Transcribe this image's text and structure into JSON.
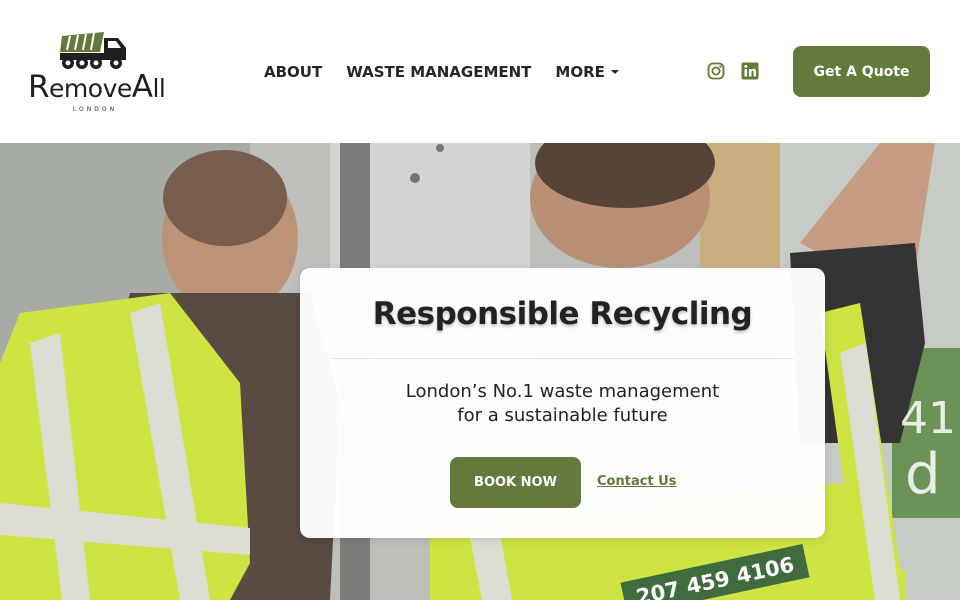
{
  "brand": {
    "name_prefix": "R",
    "name_mid": "emove",
    "name_cap2": "A",
    "name_suffix": "ll",
    "sub": "LONDON",
    "logo_icon": "truck-icon"
  },
  "nav": {
    "items": [
      {
        "label": "ABOUT"
      },
      {
        "label": "WASTE MANAGEMENT"
      },
      {
        "label": "MORE",
        "has_dropdown": true
      }
    ]
  },
  "social": {
    "icons": [
      "instagram-icon",
      "linkedin-icon"
    ]
  },
  "header": {
    "quote_label": "Get A Quote"
  },
  "hero": {
    "title": "Responsible Recycling",
    "subtitle_line1": "London’s No.1 waste management",
    "subtitle_line2": "for a sustainable future",
    "book_label": "BOOK NOW",
    "contact_label": "Contact Us",
    "vest_phone": "207 459 4106"
  },
  "colors": {
    "accent": "#637a3a",
    "text": "#262626",
    "vest": "#c9e234"
  }
}
